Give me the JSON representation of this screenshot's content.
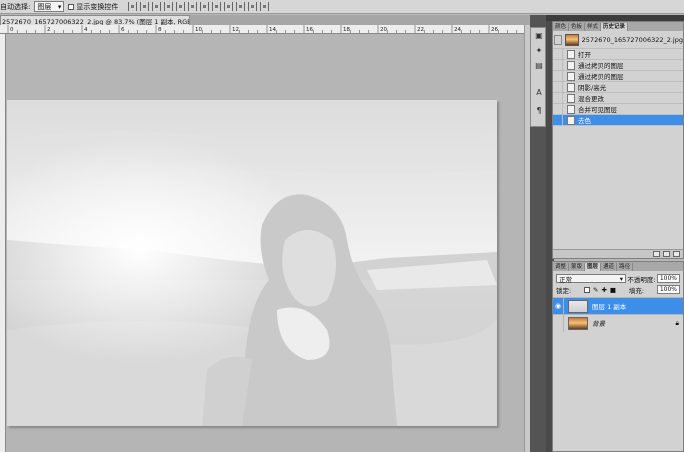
{
  "options_bar": {
    "auto_select_label": "自动选择:",
    "auto_select_value": "图层",
    "show_transform_label": "显示变换控件"
  },
  "document": {
    "tab_title": "2572670_165727006322_2.jpg @ 83.7% (图层 1 副本, RGB/8#) *",
    "ruler_numbers": [
      "0",
      "2",
      "4",
      "6",
      "8",
      "10",
      "12",
      "14",
      "16",
      "18",
      "20",
      "22",
      "24",
      "26"
    ]
  },
  "history_panel": {
    "tabs": [
      "颜色",
      "色板",
      "样式",
      "历史记录"
    ],
    "active_tab": "历史记录",
    "snapshot_name": "2572670_165727006322_2.jpg",
    "items": [
      {
        "label": "打开",
        "active": false
      },
      {
        "label": "通过拷贝的图层",
        "active": false
      },
      {
        "label": "通过拷贝的图层",
        "active": false
      },
      {
        "label": "阴影/高光",
        "active": false
      },
      {
        "label": "混合更改",
        "active": false
      },
      {
        "label": "合并可见图层",
        "active": false
      },
      {
        "label": "去色",
        "active": true
      }
    ]
  },
  "layers_panel": {
    "tabs": [
      "调整",
      "蒙版",
      "图层",
      "通道",
      "路径"
    ],
    "active_tab": "图层",
    "blend_mode": "正常",
    "opacity_label": "不透明度:",
    "opacity_value": "100%",
    "lock_label": "锁定:",
    "fill_label": "填充:",
    "fill_value": "100%",
    "layers": [
      {
        "name": "图层 1 副本",
        "active": true,
        "visible": true,
        "locked": false
      },
      {
        "name": "背景",
        "active": false,
        "visible": false,
        "locked": true
      }
    ]
  },
  "colors": {
    "selection_blue": "#3d8ee8",
    "panel_bg": "#d2d2d2",
    "canvas_bg": "#b5b5b5",
    "dark_dock": "#545454"
  }
}
